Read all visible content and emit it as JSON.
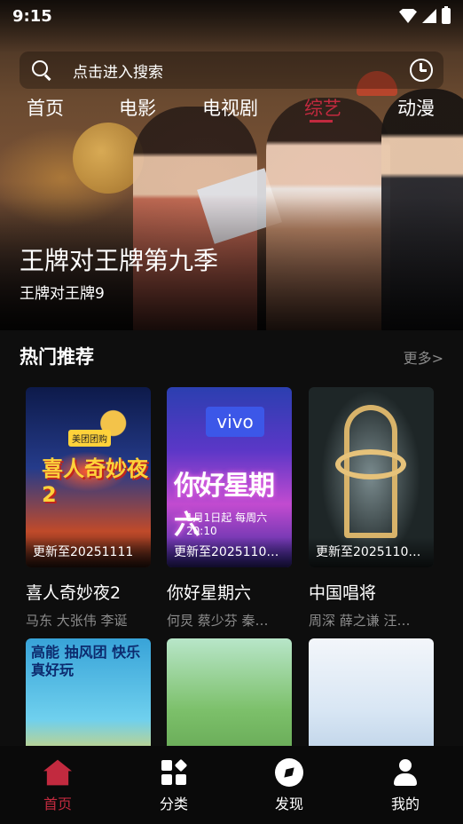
{
  "status_bar": {
    "time": "9:15"
  },
  "search": {
    "placeholder": "点击进入搜索"
  },
  "tabs": [
    {
      "label": "首页",
      "active": false
    },
    {
      "label": "电影",
      "active": false
    },
    {
      "label": "电视剧",
      "active": false
    },
    {
      "label": "综艺",
      "active": true
    },
    {
      "label": "动漫",
      "active": false
    }
  ],
  "hero": {
    "title": "王牌对王牌第九季",
    "subtitle": "王牌对王牌9"
  },
  "section": {
    "title": "热门推荐",
    "more": "更多>"
  },
  "cards": [
    {
      "title": "喜人奇妙夜2",
      "cast": "马东  大张伟  李诞",
      "badge": "更新至20251111",
      "poster_text": "喜人奇妙夜2",
      "poster_tag": "美团团购"
    },
    {
      "title": "你好星期六",
      "cast": "何炅  蔡少芬  秦…",
      "badge": "更新至2025110…",
      "poster_text": "你好星期六",
      "poster_brand": "vivo",
      "poster_date": "1月1日起 每周六 20:10"
    },
    {
      "title": "中国唱将",
      "cast": "周深  薛之谦  汪…",
      "badge": "更新至2025110…"
    },
    {
      "title": "",
      "cast": "",
      "badge": "",
      "poster_text": "高能 抽风团 快乐 真好玩"
    },
    {
      "title": "",
      "cast": "",
      "badge": ""
    },
    {
      "title": "",
      "cast": "",
      "badge": ""
    }
  ],
  "bottom_nav": [
    {
      "label": "首页",
      "icon": "home-icon",
      "active": true
    },
    {
      "label": "分类",
      "icon": "grid-icon",
      "active": false
    },
    {
      "label": "发现",
      "icon": "compass-icon",
      "active": false
    },
    {
      "label": "我的",
      "icon": "user-icon",
      "active": false
    }
  ],
  "colors": {
    "accent": "#c22a3f",
    "background": "#0e0e0e",
    "muted_text": "#8c8c8c"
  }
}
